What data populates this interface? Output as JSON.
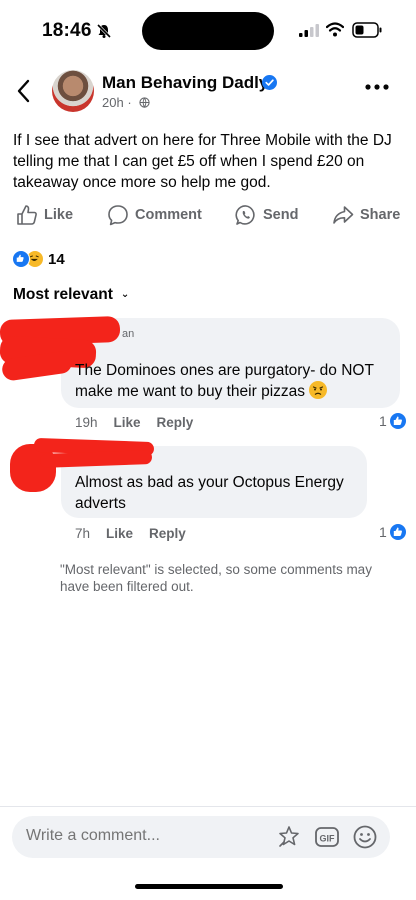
{
  "status_bar": {
    "time": "18:46"
  },
  "post": {
    "author": "Man Behaving Dadly",
    "time": "20h",
    "time_separator": "·",
    "text": "If I see that advert on here for Three Mobile with the DJ telling me that I can get £5 off when I spend £20 on takeaway once more so help me god.",
    "actions": [
      {
        "label": "Like",
        "icon": "thumbs-up-icon"
      },
      {
        "label": "Comment",
        "icon": "comment-icon"
      },
      {
        "label": "Send",
        "icon": "whatsapp-icon"
      },
      {
        "label": "Share",
        "icon": "share-icon"
      }
    ],
    "reaction_count": "14"
  },
  "sort_label": "Most relevant",
  "comments": [
    {
      "name_visible": "an",
      "text": "The Dominoes ones are purgatory- do NOT make me want to buy their pizzas",
      "time": "19h",
      "like_label": "Like",
      "reply_label": "Reply",
      "likes": "1"
    },
    {
      "text": "Almost as bad as your Octopus Energy adverts",
      "time": "7h",
      "like_label": "Like",
      "reply_label": "Reply",
      "likes": "1"
    }
  ],
  "filter_notice": "\"Most relevant\" is selected, so some comments may have been filtered out.",
  "composer": {
    "placeholder": "Write a comment..."
  },
  "colors": {
    "accent": "#1877f2",
    "redaction": "#f3241b",
    "bubble": "#f0f2f5",
    "muted": "#65676b"
  }
}
